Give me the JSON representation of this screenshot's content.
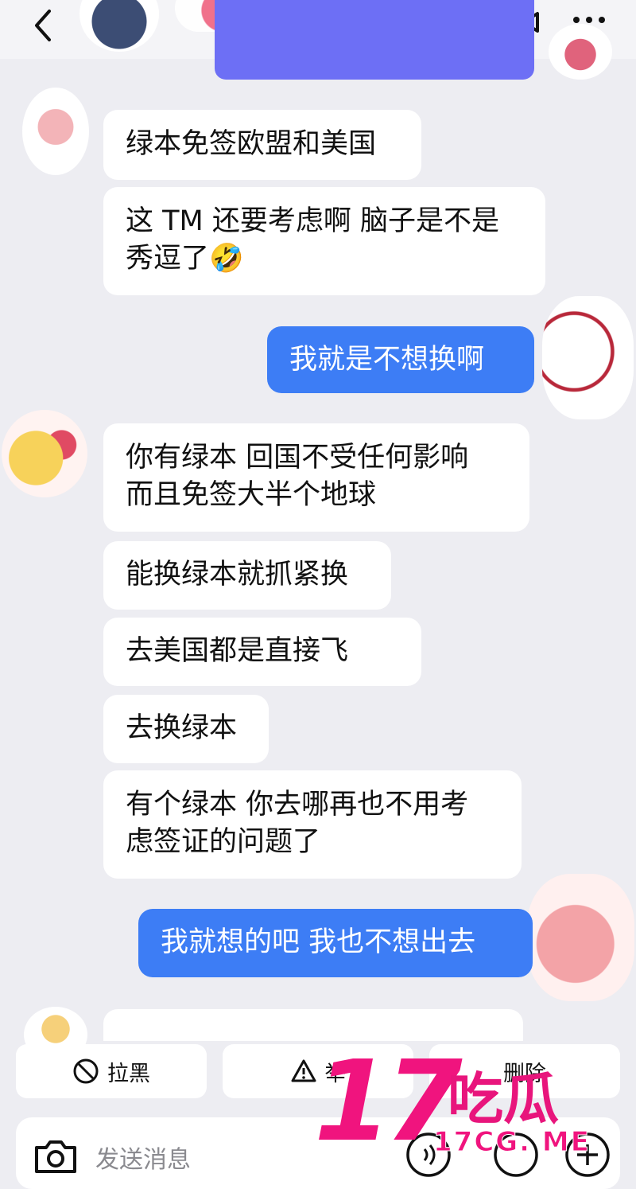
{
  "header": {
    "back_icon": "chevron-left-icon",
    "contact_name": "",
    "video_icon": "video-camera-icon",
    "more_icon": "more-dots-icon"
  },
  "messages": [
    {
      "side": "in",
      "text_lines": [
        "绿本免签欧盟和美国"
      ]
    },
    {
      "side": "in",
      "text_lines": [
        "这 TM 还要考虑啊 脑子是不是",
        "秀逗了🤣"
      ]
    },
    {
      "side": "out",
      "text_lines": [
        "我就是不想换啊"
      ]
    },
    {
      "side": "in",
      "text_lines": [
        "你有绿本 回国不受任何影响",
        "而且免签大半个地球"
      ]
    },
    {
      "side": "in",
      "text_lines": [
        "能换绿本就抓紧换"
      ]
    },
    {
      "side": "in",
      "text_lines": [
        "去美国都是直接飞"
      ]
    },
    {
      "side": "in",
      "text_lines": [
        "去换绿本"
      ]
    },
    {
      "side": "in",
      "text_lines": [
        "有个绿本 你去哪再也不用考",
        "虑签证的问题了"
      ]
    },
    {
      "side": "out",
      "text_lines": [
        "我就想的吧 我也不想出去"
      ]
    }
  ],
  "actions": {
    "block_label": "拉黑",
    "report_label": "举",
    "delete_label": "删除"
  },
  "input": {
    "placeholder": "发送消息"
  },
  "watermark": {
    "number": "17",
    "cn": "吃瓜",
    "url": "17CG. ME"
  },
  "colors": {
    "background": "#ededf2",
    "incoming_bubble": "#ffffff",
    "outgoing_bubble": "#3d7df5",
    "watermark": "#f0147e"
  }
}
